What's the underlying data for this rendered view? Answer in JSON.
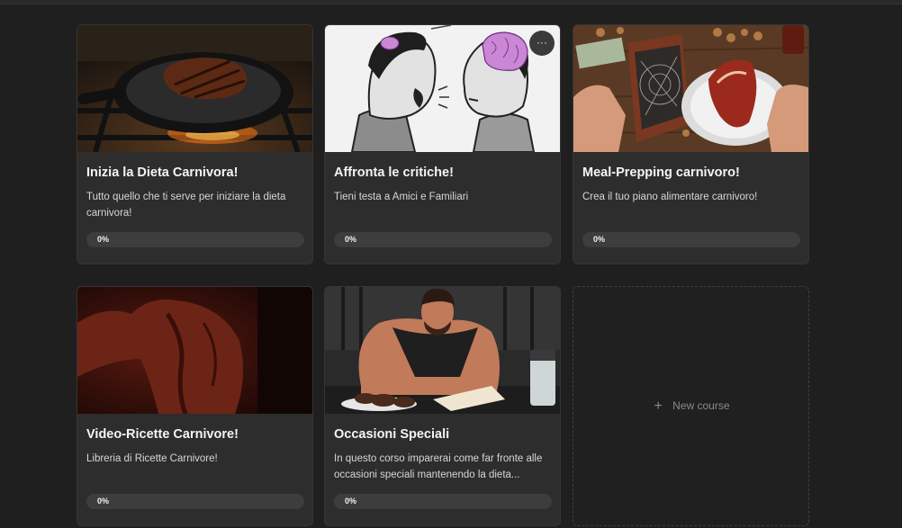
{
  "courses": [
    {
      "title": "Inizia la Dieta Carnivora!",
      "description": "Tutto quello che ti serve per iniziare la dieta carnivora!",
      "progress_label": "0%",
      "progress": 0
    },
    {
      "title": "Affronta le critiche!",
      "description": "Tieni testa a Amici e Familiari",
      "progress_label": "0%",
      "progress": 0,
      "more_label": "···"
    },
    {
      "title": "Meal-Prepping carnivoro!",
      "description": "Crea il tuo piano alimentare carnivoro!",
      "progress_label": "0%",
      "progress": 0
    },
    {
      "title": "Video-Ricette Carnivore!",
      "description": "Libreria di Ricette Carnivore!",
      "progress_label": "0%",
      "progress": 0
    },
    {
      "title": "Occasioni Speciali",
      "description": "In questo corso imparerai come far fronte alle occasioni speciali mantenendo la dieta...",
      "progress_label": "0%",
      "progress": 0
    }
  ],
  "new_course": {
    "icon": "plus-icon",
    "plus": "+",
    "label": "New course"
  },
  "colors": {
    "background": "#1f1f1f",
    "card": "#2d2d2d",
    "progress_track": "#3d3d3d",
    "brain": "#c987d6"
  }
}
